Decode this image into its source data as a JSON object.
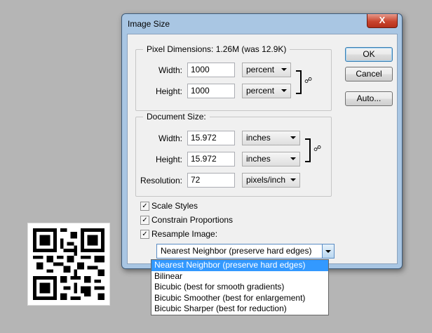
{
  "dialog": {
    "title": "Image Size",
    "close_label": "X",
    "pixel_dimensions": {
      "legend": "Pixel Dimensions:",
      "size": "1.26M (was 12.9K)",
      "width_label": "Width:",
      "width_value": "1000",
      "width_unit": "percent",
      "height_label": "Height:",
      "height_value": "1000",
      "height_unit": "percent"
    },
    "document_size": {
      "legend": "Document Size:",
      "width_label": "Width:",
      "width_value": "15.972",
      "width_unit": "inches",
      "height_label": "Height:",
      "height_value": "15.972",
      "height_unit": "inches",
      "resolution_label": "Resolution:",
      "resolution_value": "72",
      "resolution_unit": "pixels/inch"
    },
    "buttons": {
      "ok": "OK",
      "cancel": "Cancel",
      "auto": "Auto..."
    },
    "options": {
      "scale_styles": {
        "label": "Scale Styles",
        "checked": true
      },
      "constrain_proportions": {
        "label": "Constrain Proportions",
        "checked": true
      },
      "resample_image": {
        "label": "Resample Image:",
        "checked": true
      }
    },
    "resample_method": "Nearest Neighbor (preserve hard edges)"
  },
  "resample_menu": {
    "items": [
      {
        "label": "Nearest Neighbor (preserve hard edges)",
        "selected": true
      },
      {
        "label": "Bilinear",
        "selected": false
      },
      {
        "label": "Bicubic (best for smooth gradients)",
        "selected": false
      },
      {
        "label": "Bicubic Smoother (best for enlargement)",
        "selected": false
      },
      {
        "label": "Bicubic Sharper (best for reduction)",
        "selected": false
      }
    ]
  },
  "icons": {
    "link": "chain-link-icon",
    "checkmark": "✓",
    "close": "close-icon"
  }
}
